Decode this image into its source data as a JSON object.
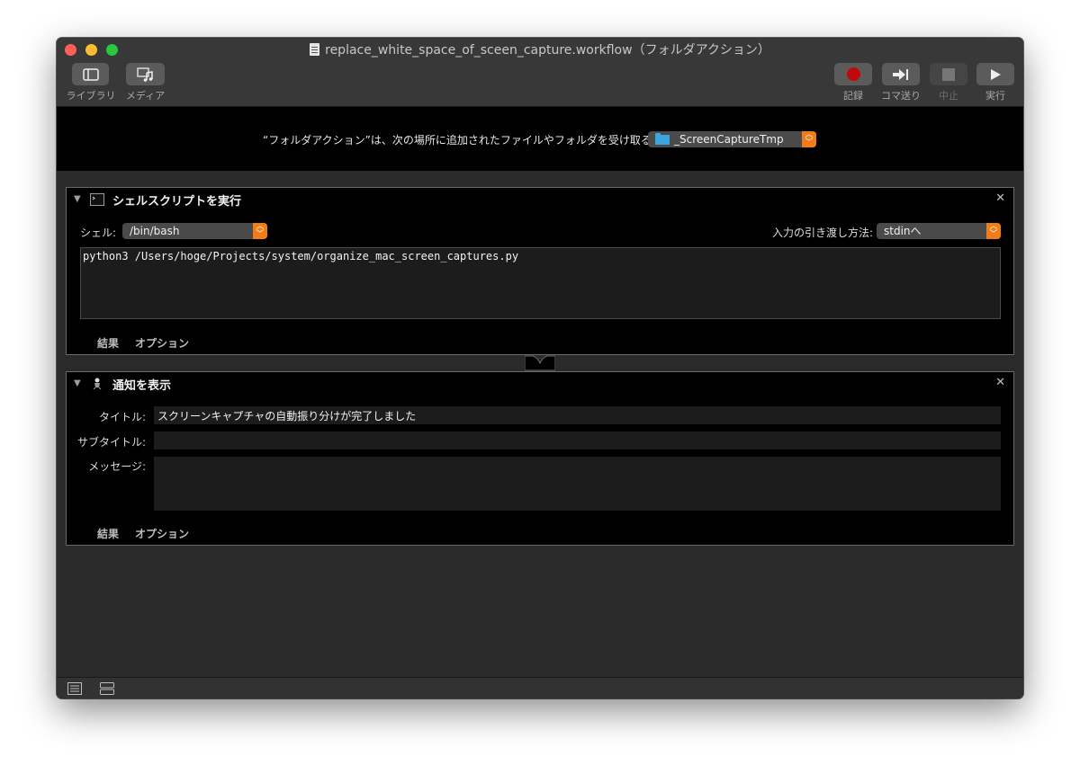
{
  "window": {
    "title": "replace_white_space_of_sceen_capture.workflow（フォルダアクション）"
  },
  "toolbar": {
    "library_label": "ライブラリ",
    "media_label": "メディア",
    "record_label": "記録",
    "step_label": "コマ送り",
    "stop_label": "中止",
    "run_label": "実行"
  },
  "folder_action": {
    "description": "“フォルダアクション”は、次の場所に追加されたファイルやフォルダを受け取る:",
    "folder": "_ScreenCaptureTmp"
  },
  "shell_action": {
    "title": "シェルスクリプトを実行",
    "shell_label": "シェル:",
    "shell_value": "/bin/bash",
    "input_label": "入力の引き渡し方法:",
    "input_value": "stdinへ",
    "script": "python3 /Users/hoge/Projects/system/organize_mac_screen_captures.py",
    "tab_results": "結果",
    "tab_options": "オプション"
  },
  "notify_action": {
    "title": "通知を表示",
    "title_label": "タイトル:",
    "title_value": "スクリーンキャプチャの自動振り分けが完了しました",
    "subtitle_label": "サブタイトル:",
    "subtitle_value": "",
    "message_label": "メッセージ:",
    "message_value": "",
    "tab_results": "結果",
    "tab_options": "オプション"
  },
  "colors": {
    "accent": "#f07d19",
    "record": "#c00a0a",
    "folder": "#3aa6e0"
  }
}
